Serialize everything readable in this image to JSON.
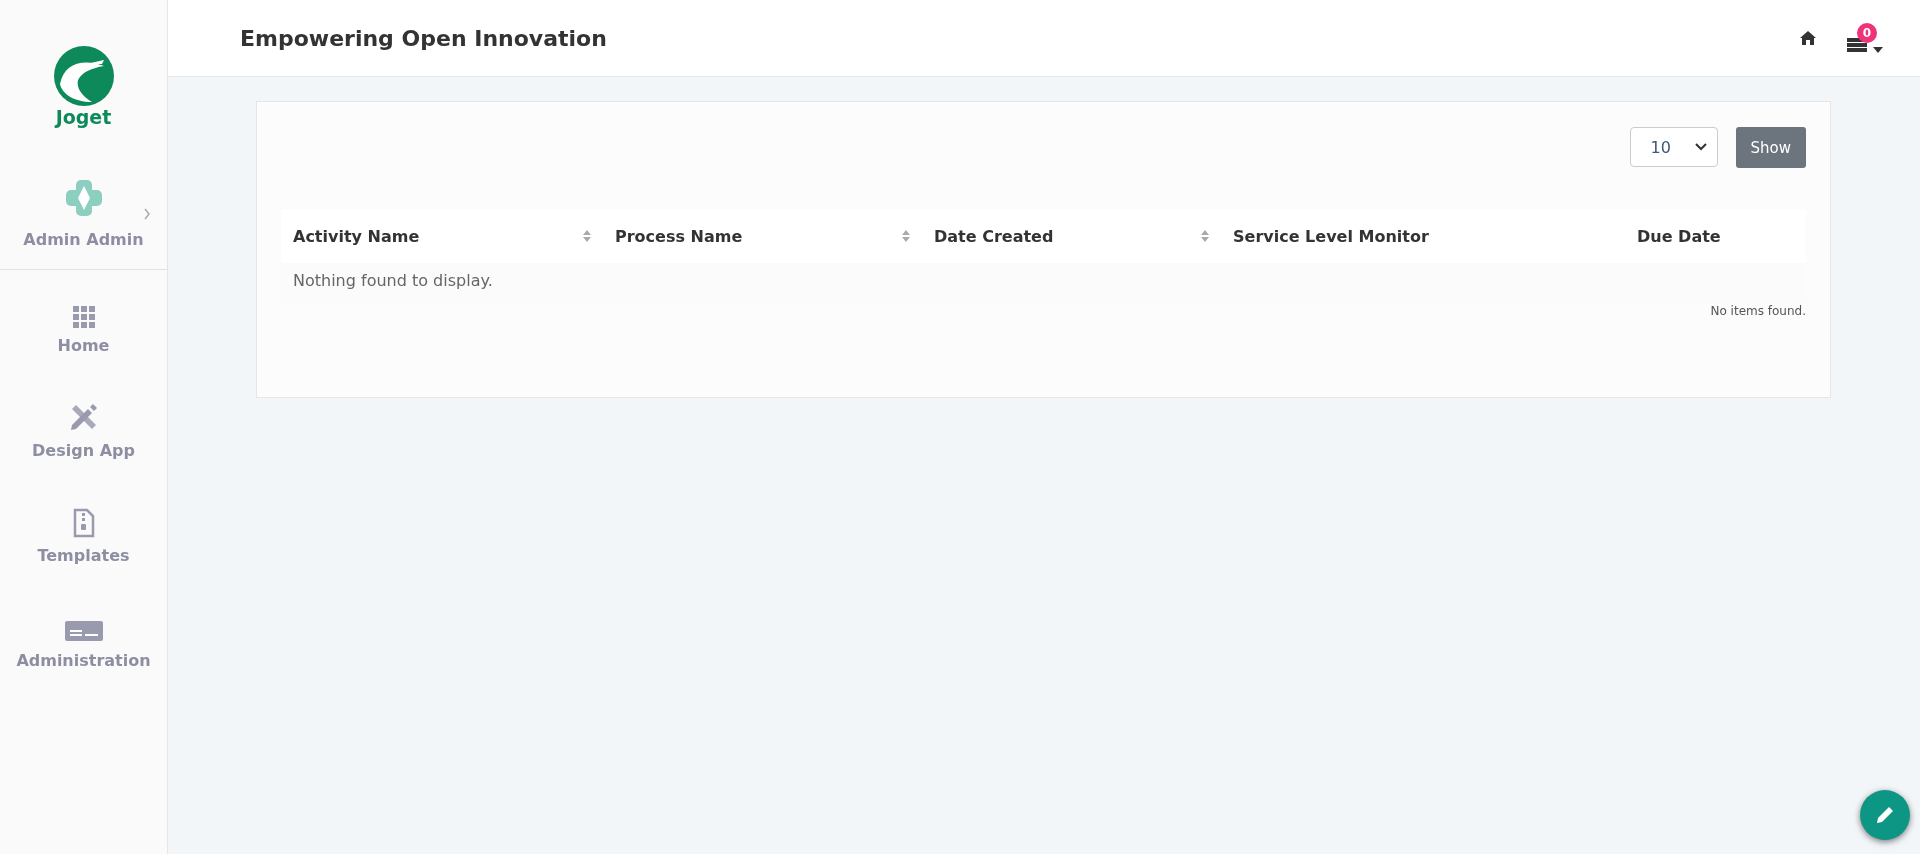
{
  "sidebar": {
    "logo_text": "Joget",
    "user": "Admin Admin",
    "items": [
      {
        "label": "Home",
        "kind": "home"
      },
      {
        "label": "Design App",
        "kind": "design"
      },
      {
        "label": "Templates",
        "kind": "templates"
      },
      {
        "label": "Administration",
        "kind": "admin"
      }
    ]
  },
  "header": {
    "title": "Empowering Open Innovation",
    "notification_count": "0"
  },
  "list": {
    "page_size": "10",
    "show_button": "Show",
    "columns": [
      {
        "label": "Activity Name",
        "sortable": true
      },
      {
        "label": "Process Name",
        "sortable": true
      },
      {
        "label": "Date Created",
        "sortable": true
      },
      {
        "label": "Service Level Monitor",
        "sortable": false
      },
      {
        "label": "Due Date",
        "sortable": false
      }
    ],
    "empty_message": "Nothing found to display.",
    "footer": "No items found."
  }
}
